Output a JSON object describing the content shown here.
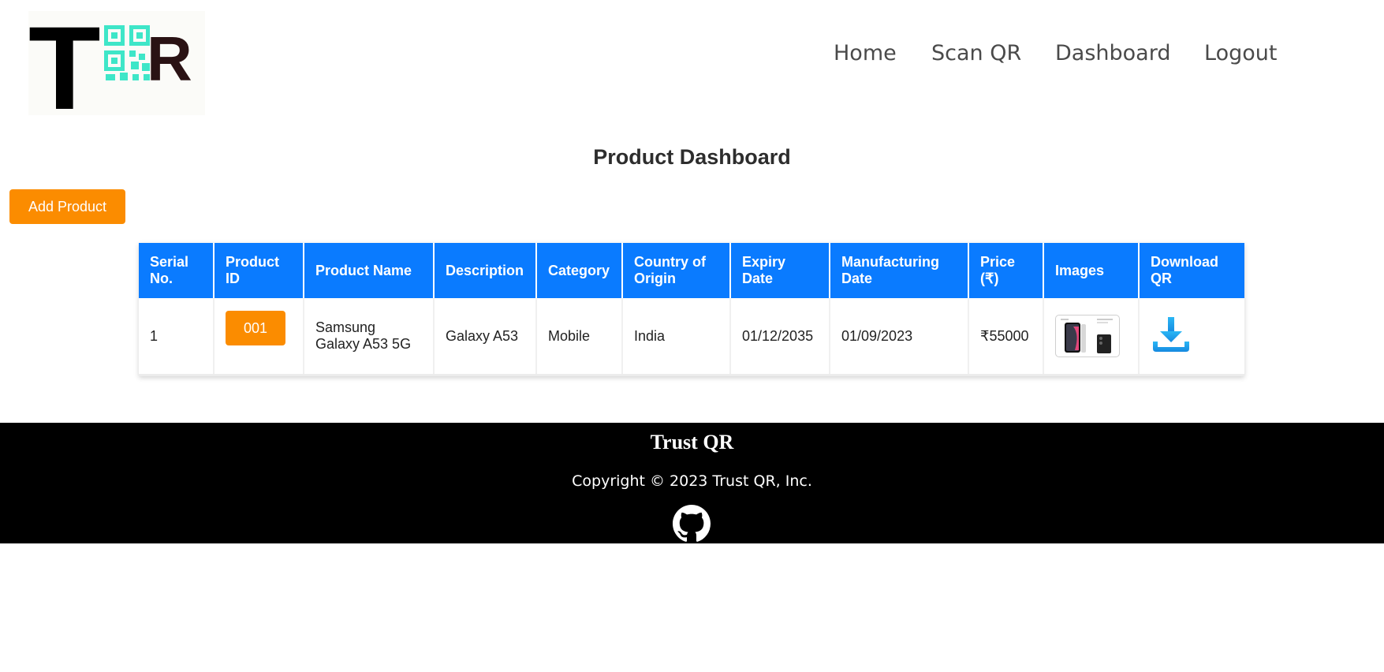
{
  "nav": {
    "home": "Home",
    "scan_qr": "Scan QR",
    "dashboard": "Dashboard",
    "logout": "Logout"
  },
  "logo": {
    "letter_left": "T",
    "letter_right": "R"
  },
  "page": {
    "title": "Product Dashboard",
    "add_product_label": "Add Product"
  },
  "table": {
    "headers": [
      "Serial No.",
      "Product ID",
      "Product Name",
      "Description",
      "Category",
      "Country of Origin",
      "Expiry Date",
      "Manufacturing Date",
      "Price (₹)",
      "Images",
      "Download QR"
    ],
    "rows": [
      {
        "serial": "1",
        "product_id": "001",
        "name": "Samsung Galaxy A53 5G",
        "description": "Galaxy A53",
        "category": "Mobile",
        "country": "India",
        "expiry": "01/12/2035",
        "manufacturing": "01/09/2023",
        "price": "₹55000"
      }
    ]
  },
  "footer": {
    "brand": "Trust QR",
    "copyright": "Copyright © 2023 Trust QR, Inc."
  },
  "colors": {
    "accent_orange": "#fb8c00",
    "header_blue": "#0a7bff",
    "qr_teal": "#3ee6c8",
    "download_blue": "#1aa3ee"
  },
  "icons": {
    "download": "download-icon",
    "github": "github-icon",
    "product_image": "product-image-thumbnail"
  }
}
